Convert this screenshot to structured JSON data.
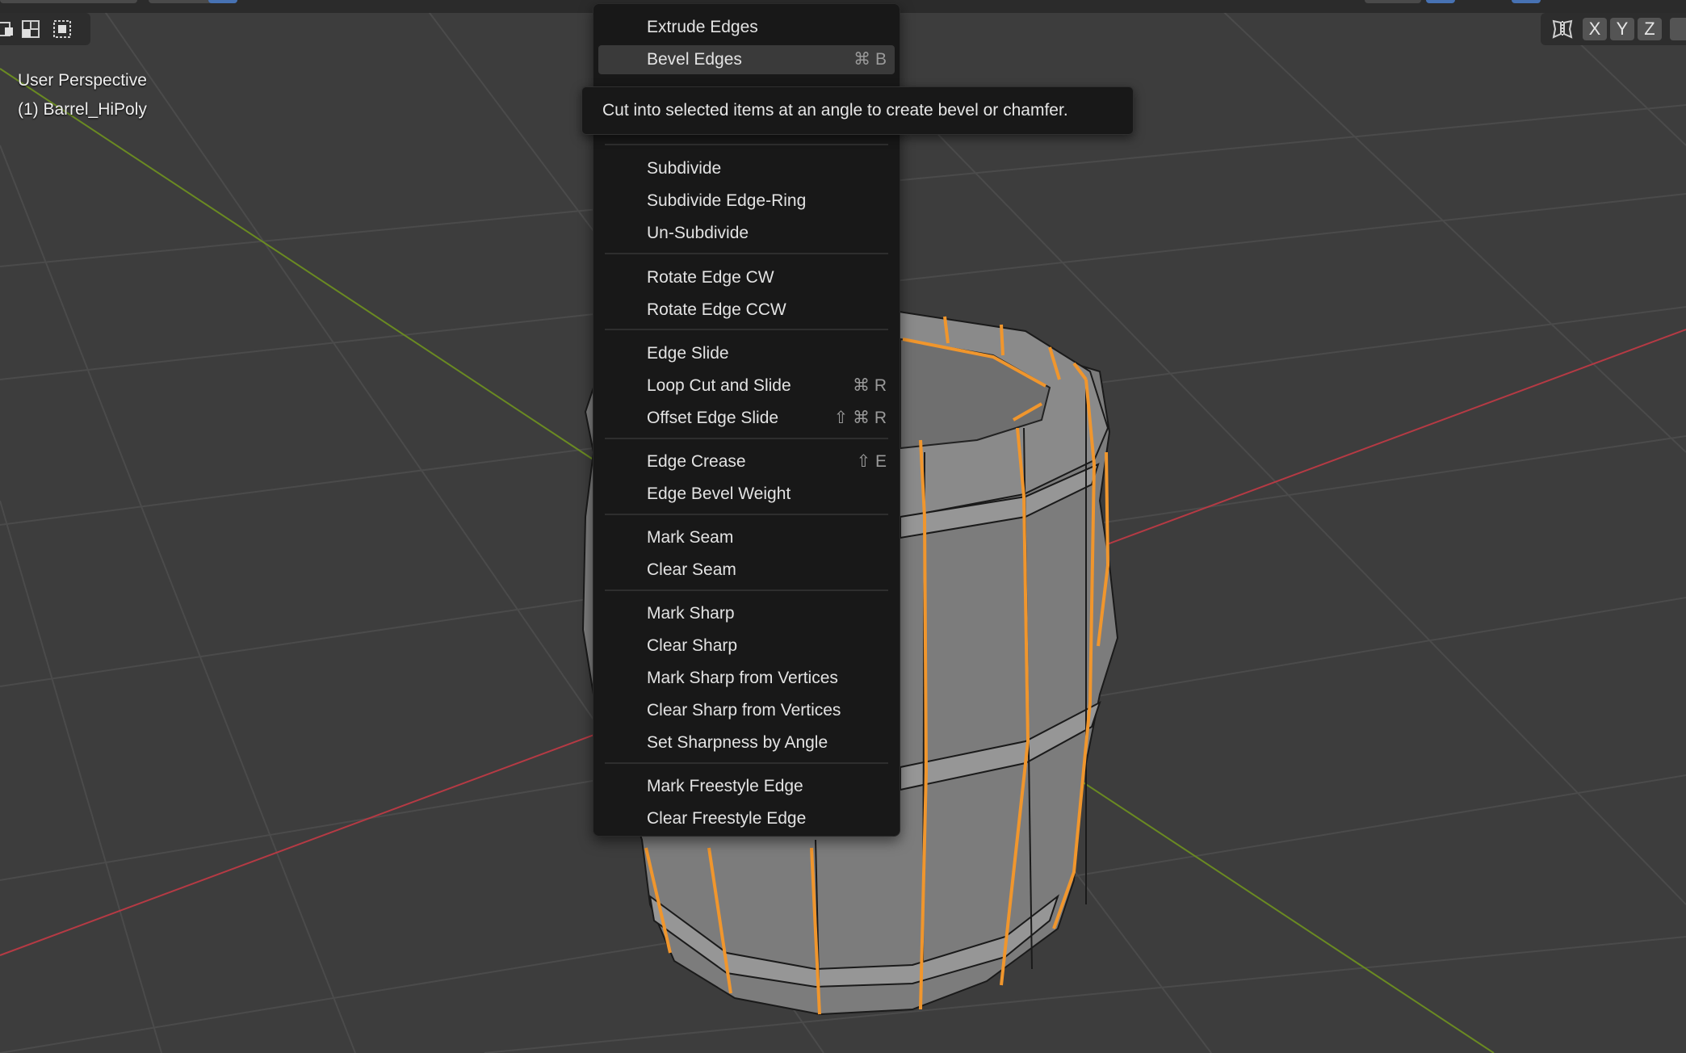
{
  "viewport": {
    "view_name": "User Perspective",
    "object_name": "(1) Barrel_HiPoly"
  },
  "axis_buttons": [
    "X",
    "Y",
    "Z"
  ],
  "colors": {
    "selected_edge": "#f0962d",
    "x_axis": "#b53a44",
    "y_axis": "#6a8a22",
    "highlight": "#3a3a3a",
    "accent_blue": "#4772b3"
  },
  "context_menu": {
    "items": [
      {
        "label": "Extrude Edges",
        "shortcut": ""
      },
      {
        "label": "Bevel Edges",
        "shortcut": "⌘ B",
        "highlighted": true
      },
      {
        "label": "Subdivide",
        "shortcut": ""
      },
      {
        "label": "Subdivide Edge-Ring",
        "shortcut": ""
      },
      {
        "label": "Un-Subdivide",
        "shortcut": ""
      },
      {
        "label": "Rotate Edge CW",
        "shortcut": ""
      },
      {
        "label": "Rotate Edge CCW",
        "shortcut": ""
      },
      {
        "label": "Edge Slide",
        "shortcut": ""
      },
      {
        "label": "Loop Cut and Slide",
        "shortcut": "⌘ R"
      },
      {
        "label": "Offset Edge Slide",
        "shortcut": "⇧ ⌘ R"
      },
      {
        "label": "Edge Crease",
        "shortcut": "⇧ E"
      },
      {
        "label": "Edge Bevel Weight",
        "shortcut": ""
      },
      {
        "label": "Mark Seam",
        "shortcut": ""
      },
      {
        "label": "Clear Seam",
        "shortcut": ""
      },
      {
        "label": "Mark Sharp",
        "shortcut": ""
      },
      {
        "label": "Clear Sharp",
        "shortcut": ""
      },
      {
        "label": "Mark Sharp from Vertices",
        "shortcut": ""
      },
      {
        "label": "Clear Sharp from Vertices",
        "shortcut": ""
      },
      {
        "label": "Set Sharpness by Angle",
        "shortcut": ""
      },
      {
        "label": "Mark Freestyle Edge",
        "shortcut": ""
      },
      {
        "label": "Clear Freestyle Edge",
        "shortcut": ""
      }
    ]
  },
  "tooltip": {
    "text": "Cut into selected items at an angle to create bevel or chamfer."
  }
}
